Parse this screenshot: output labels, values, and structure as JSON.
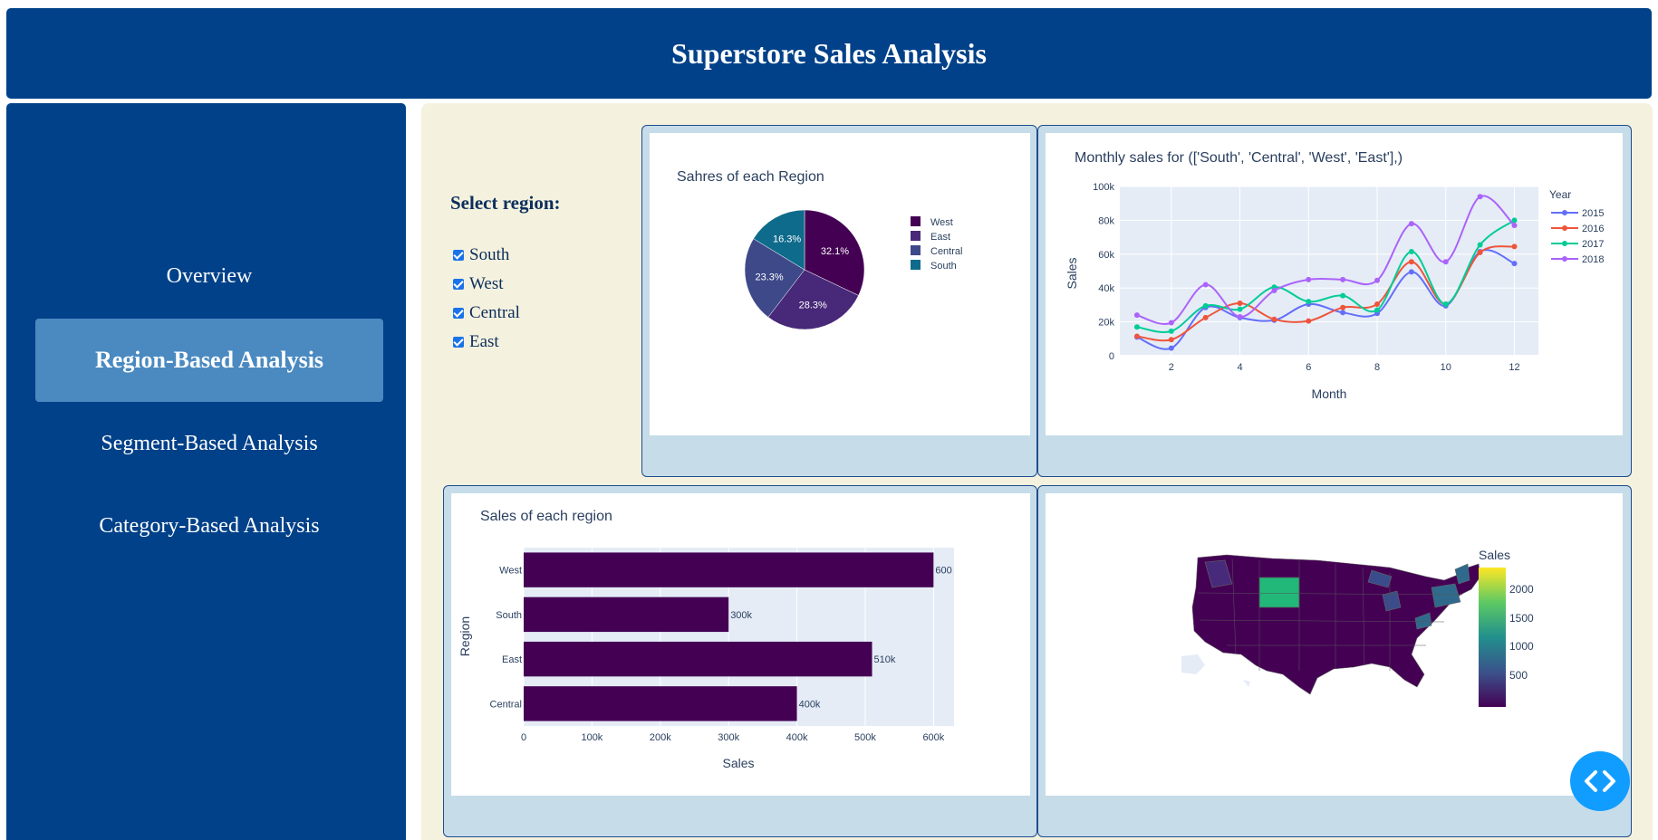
{
  "header": {
    "title": "Superstore Sales Analysis"
  },
  "sidebar": {
    "items": [
      {
        "label": "Overview",
        "active": false
      },
      {
        "label": "Region-Based Analysis",
        "active": true
      },
      {
        "label": "Segment-Based Analysis",
        "active": false
      },
      {
        "label": "Category-Based Analysis",
        "active": false
      }
    ]
  },
  "controls": {
    "title": "Select region:",
    "options": [
      {
        "label": "South",
        "checked": true
      },
      {
        "label": "West",
        "checked": true
      },
      {
        "label": "Central",
        "checked": true
      },
      {
        "label": "East",
        "checked": true
      }
    ]
  },
  "pie": {
    "title": "Sahres of each Region",
    "chart_data": {
      "type": "pie",
      "labels": [
        "West",
        "East",
        "Central",
        "South"
      ],
      "values": [
        32.1,
        28.3,
        23.3,
        16.3
      ],
      "value_labels": [
        "32.1%",
        "28.3%",
        "23.3%",
        "16.3%"
      ],
      "colors": [
        "#440154",
        "#482878",
        "#3e4989",
        "#0e6b8c"
      ],
      "legend": "right"
    }
  },
  "line": {
    "title": "Monthly sales for (['South', 'Central', 'West', 'East'],)",
    "chart_data": {
      "type": "line",
      "xlabel": "Month",
      "ylabel": "Sales",
      "x": [
        1,
        2,
        3,
        4,
        5,
        6,
        7,
        8,
        9,
        10,
        11,
        12
      ],
      "xticks": [
        "2",
        "4",
        "6",
        "8",
        "10",
        "12"
      ],
      "yticks": [
        "0",
        "20k",
        "40k",
        "60k",
        "80k",
        "100k"
      ],
      "ylim": [
        0,
        100000
      ],
      "legend_title": "Year",
      "series": [
        {
          "name": "2015",
          "color": "#636efa",
          "values": [
            11000,
            4500,
            28500,
            22500,
            21000,
            30500,
            25500,
            25000,
            49500,
            29500,
            61500,
            54500
          ]
        },
        {
          "name": "2016",
          "color": "#ef553b",
          "values": [
            11500,
            9500,
            22500,
            31000,
            21500,
            20500,
            28500,
            30500,
            55500,
            30500,
            61000,
            64500
          ]
        },
        {
          "name": "2017",
          "color": "#00cc96",
          "values": [
            17000,
            14500,
            29500,
            27500,
            40500,
            32000,
            35500,
            27000,
            61500,
            30500,
            65500,
            80000
          ]
        },
        {
          "name": "2018",
          "color": "#ab63fa",
          "values": [
            24000,
            19500,
            42000,
            23000,
            38500,
            45000,
            45000,
            44500,
            78000,
            55500,
            94000,
            77000
          ]
        }
      ]
    }
  },
  "bar": {
    "title": "Sales of each region",
    "chart_data": {
      "type": "bar",
      "orientation": "horizontal",
      "categories": [
        "West",
        "South",
        "East",
        "Central"
      ],
      "values": [
        600,
        300,
        510,
        400
      ],
      "value_labels": [
        "600",
        "300k",
        "510k",
        "400k"
      ],
      "xlabel": "Sales",
      "ylabel": "Region",
      "xticks": [
        "0",
        "100k",
        "200k",
        "300k",
        "400k",
        "500k",
        "600k"
      ],
      "xlim": [
        0,
        630000
      ],
      "color": "#440154"
    }
  },
  "map": {
    "colorbar_title": "Sales",
    "colorbar_ticks": [
      "2000",
      "1500",
      "1000",
      "500"
    ]
  }
}
